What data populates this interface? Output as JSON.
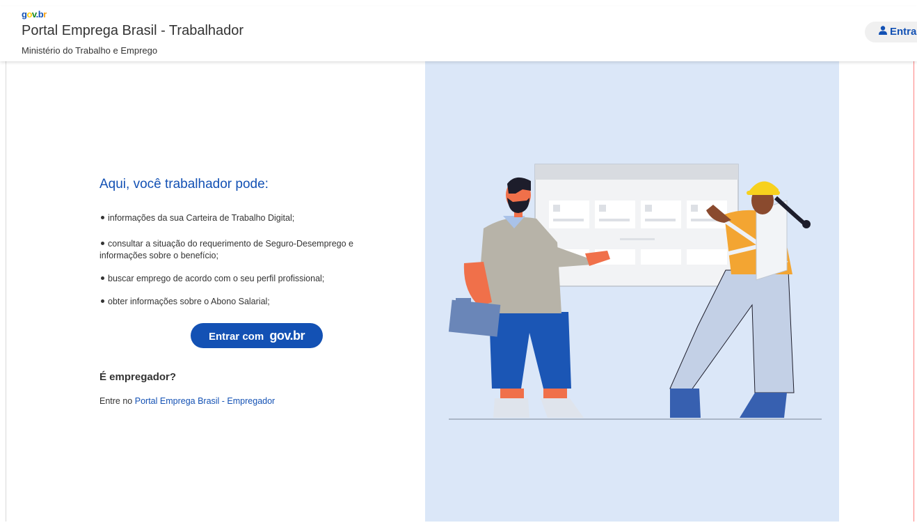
{
  "header": {
    "logo": {
      "g": "g",
      "o": "o",
      "v": "v",
      "dot": ".",
      "b": "b",
      "r": "r"
    },
    "title": "Portal Emprega Brasil - Trabalhador",
    "subtitle": "Ministério do Trabalho e Emprego",
    "login_label": "Entra"
  },
  "main": {
    "heading": "Aqui, você trabalhador pode:",
    "bullets": [
      "informações da sua Carteira de Trabalho Digital;",
      "consultar a situação do requerimento de Seguro-Desemprego e informações sobre o benefício;",
      "buscar emprego de acordo com o seu perfil profissional;",
      "obter informações sobre o Abono Salarial;"
    ],
    "enter_button": {
      "prefix": "Entrar com",
      "brand": "gov.br"
    },
    "employer_question": "É empregador?",
    "employer_text": "Entre no",
    "employer_link": "Portal Emprega Brasil - Empregador"
  },
  "colors": {
    "primary": "#1351b4",
    "illustration_bg": "#dbe7f8"
  }
}
